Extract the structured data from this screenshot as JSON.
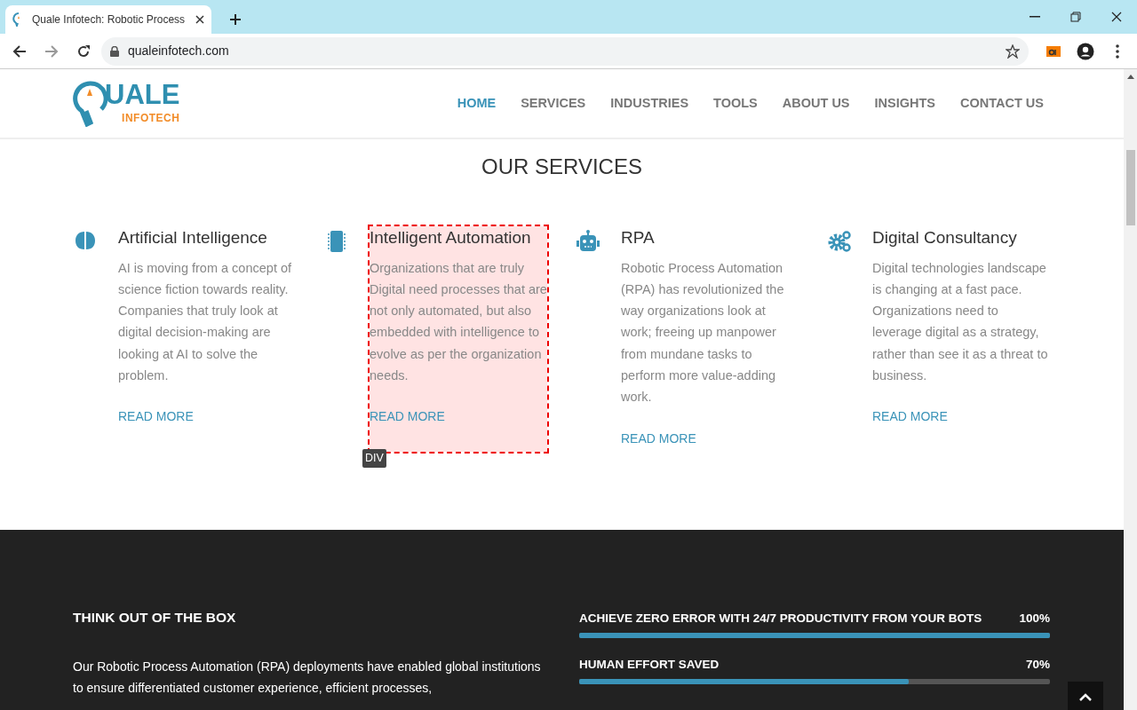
{
  "browser": {
    "tab_title": "Quale Infotech: Robotic Process",
    "url": "qualeinfotech.com"
  },
  "logo": {
    "word": "UALE",
    "sub": "INFOTECH"
  },
  "nav": [
    {
      "label": "HOME",
      "selected": true
    },
    {
      "label": "SERVICES",
      "selected": false
    },
    {
      "label": "INDUSTRIES",
      "selected": false
    },
    {
      "label": "TOOLS",
      "selected": false
    },
    {
      "label": "ABOUT US",
      "selected": false
    },
    {
      "label": "INSIGHTS",
      "selected": false
    },
    {
      "label": "CONTACT US",
      "selected": false
    }
  ],
  "services_title": "OUR SERVICES",
  "services": [
    {
      "title": "Artificial Intelligence",
      "text": "AI is moving from a concept of science fiction towards reality. Companies that truly look at digital decision-making are looking at AI to solve the problem.",
      "link": "READ MORE",
      "highlighted": false
    },
    {
      "title": "Intelligent Automation",
      "text": "Organizations that are truly Digital need processes that are not only automated, but also embedded with intelligence to evolve as per the organization needs.",
      "link": "READ MORE",
      "highlighted": true
    },
    {
      "title": "RPA",
      "text": "Robotic Process Automation (RPA) has revolutionized the way organizations look at work; freeing up manpower from mundane tasks to perform more value-adding work.",
      "link": "READ MORE",
      "highlighted": false
    },
    {
      "title": "Digital Consultancy",
      "text": "Digital technologies landscape is changing at a fast pace. Organizations need to leverage digital as a strategy, rather than see it as a threat to business.",
      "link": "READ MORE",
      "highlighted": false
    }
  ],
  "inspector_tag": "DIV",
  "think": {
    "title": "THINK OUT OF THE BOX",
    "text": "Our Robotic Process Automation (RPA) deployments have enabled global institutions to ensure differentiated customer experience, efficient processes,"
  },
  "stats": [
    {
      "label": "ACHIEVE ZERO ERROR WITH 24/7 PRODUCTIVITY FROM YOUR BOTS",
      "reading": "100%",
      "level": 1.0
    },
    {
      "label": "HUMAN EFFORT SAVED",
      "reading": "70%",
      "level": 0.7
    }
  ]
}
